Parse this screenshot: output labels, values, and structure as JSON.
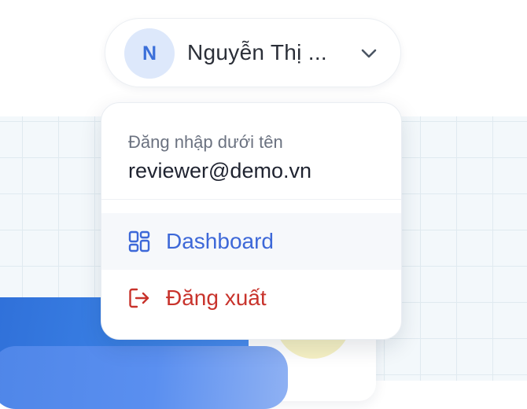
{
  "user_menu": {
    "avatar_initial": "N",
    "display_name": "Nguyễn Thị ...",
    "chevron_icon": "chevron-down-icon"
  },
  "dropdown": {
    "signed_in_label": "Đăng nhập dưới tên",
    "signed_in_email": "reviewer@demo.vn",
    "items": [
      {
        "label": "Dashboard",
        "icon": "dashboard-grid-icon",
        "color": "#3d68d8"
      },
      {
        "label": "Đăng xuất",
        "icon": "logout-icon",
        "color": "#c8332c"
      }
    ]
  },
  "colors": {
    "accent_blue": "#3d68d8",
    "danger_red": "#c8332c",
    "avatar_bg": "#dde8fb"
  }
}
